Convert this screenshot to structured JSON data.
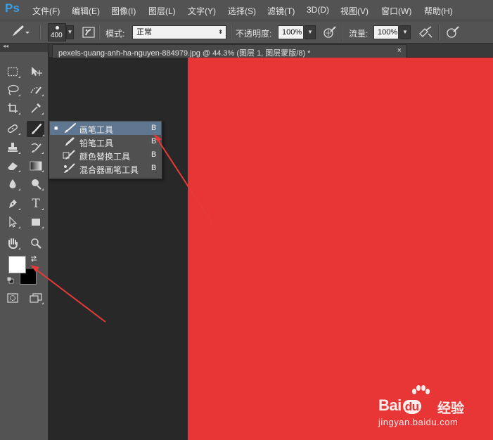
{
  "app": {
    "logo_text": "Ps"
  },
  "menu": [
    "文件(F)",
    "编辑(E)",
    "图像(I)",
    "图层(L)",
    "文字(Y)",
    "选择(S)",
    "滤镜(T)",
    "3D(D)",
    "视图(V)",
    "窗口(W)",
    "帮助(H)"
  ],
  "options": {
    "brush_size": "400",
    "mode_label": "模式:",
    "mode_value": "正常",
    "opacity_label": "不透明度:",
    "opacity_value": "100%",
    "flow_label": "流量:",
    "flow_value": "100%"
  },
  "document_tab": {
    "title": "pexels-quang-anh-ha-nguyen-884979.jpg @ 44.3% (图层 1, 图层蒙版/8) *",
    "close": "×"
  },
  "toolbox": {
    "tools": [
      "marquee-tool",
      "move-tool",
      "lasso-tool",
      "quick-selection-tool",
      "crop-tool",
      "eyedropper-tool",
      "spot-healing-tool",
      "brush-tool",
      "clone-stamp-tool",
      "history-brush-tool",
      "eraser-tool",
      "gradient-tool",
      "blur-tool",
      "dodge-tool",
      "pen-tool",
      "type-tool",
      "path-selection-tool",
      "rectangle-tool",
      "hand-tool",
      "zoom-tool"
    ],
    "selected_tool": "brush-tool",
    "type_tool_glyph": "T",
    "foreground_color": "#ffffff",
    "background_color": "#000000"
  },
  "flyout": {
    "items": [
      {
        "label": "画笔工具",
        "key": "B",
        "selected": true,
        "icon": "brush-icon"
      },
      {
        "label": "铅笔工具",
        "key": "B",
        "selected": false,
        "icon": "pencil-icon"
      },
      {
        "label": "颜色替换工具",
        "key": "B",
        "selected": false,
        "icon": "color-replacement-icon"
      },
      {
        "label": "混合器画笔工具",
        "key": "B",
        "selected": false,
        "icon": "mixer-brush-icon"
      }
    ],
    "selected_marker": "■"
  },
  "canvas": {
    "image_color": "#e83535"
  },
  "annotations": {
    "arrow_color": "#e63a3a"
  },
  "watermark": {
    "brand_left": "Bai",
    "brand_paw": "du",
    "brand_right": "经验",
    "url": "jingyan.baidu.com"
  }
}
